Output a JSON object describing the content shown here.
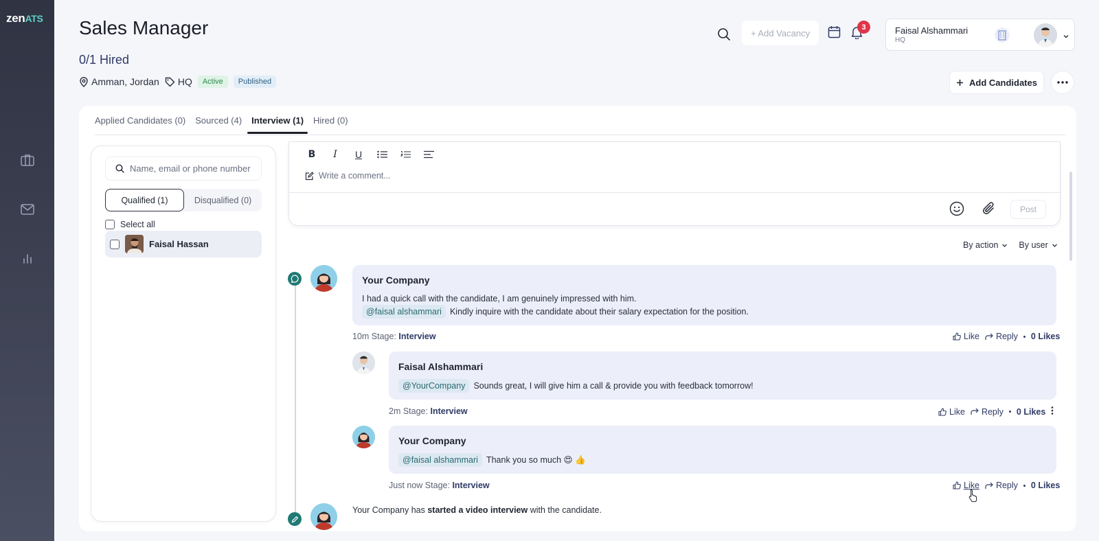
{
  "app": {
    "logo_part1": "zen",
    "logo_part2": "ATS"
  },
  "sidebar": {
    "items": [
      {
        "name": "briefcase-icon"
      },
      {
        "name": "mail-icon"
      },
      {
        "name": "chart-icon"
      }
    ]
  },
  "header": {
    "title": "Sales Manager",
    "hired": "0/1 Hired",
    "location": "Amman, Jordan",
    "tag": "HQ",
    "status_badge": "Active",
    "publish_badge": "Published",
    "add_vacancy": "+ Add Vacancy",
    "notifications_count": "3",
    "user_name": "Faisal Alshammari",
    "user_org": "HQ",
    "add_candidates": "Add Candidates"
  },
  "tabs": [
    {
      "label": "Applied Candidates (0)",
      "selected": false
    },
    {
      "label": "Sourced (4)",
      "selected": false
    },
    {
      "label": "Interview (1)",
      "selected": true
    },
    {
      "label": "Hired (0)",
      "selected": false
    }
  ],
  "candidates": {
    "search_placeholder": "Name, email or phone number",
    "qualified": "Qualified (1)",
    "disqualified": "Disqualified (0)",
    "select_all": "Select all",
    "list": [
      {
        "name": "Faisal Hassan"
      }
    ]
  },
  "comment_box": {
    "placeholder": "Write a comment...",
    "post": "Post"
  },
  "filters": {
    "by_action": "By action",
    "by_user": "By user"
  },
  "timeline": {
    "c1": {
      "author": "Your Company",
      "line1": "I had a quick call with the candidate, I am genuinely impressed with him.",
      "mention": "@faisal alshammari",
      "line2": "Kindly inquire with the candidate about their salary expectation for the position.",
      "time": "10m Stage:",
      "stage": "Interview",
      "like": "Like",
      "reply": "Reply",
      "likes": "0 Likes"
    },
    "r1": {
      "author": "Faisal Alshammari",
      "mention": "@YourCompany",
      "text": "Sounds great, I will give him a call & provide you with feedback tomorrow!",
      "time": "2m Stage:",
      "stage": "Interview",
      "like": "Like",
      "reply": "Reply",
      "likes": "0 Likes"
    },
    "r2": {
      "author": "Your Company",
      "mention": "@faisal alshammari",
      "text": "Thank you so much 😍 👍",
      "time": "Just now Stage:",
      "stage": "Interview",
      "like": "Like",
      "reply": "Reply",
      "likes": "0 Likes"
    },
    "activity": {
      "pre": "Your Company has",
      "bold": "started a video interview",
      "post": "with the candidate."
    }
  }
}
